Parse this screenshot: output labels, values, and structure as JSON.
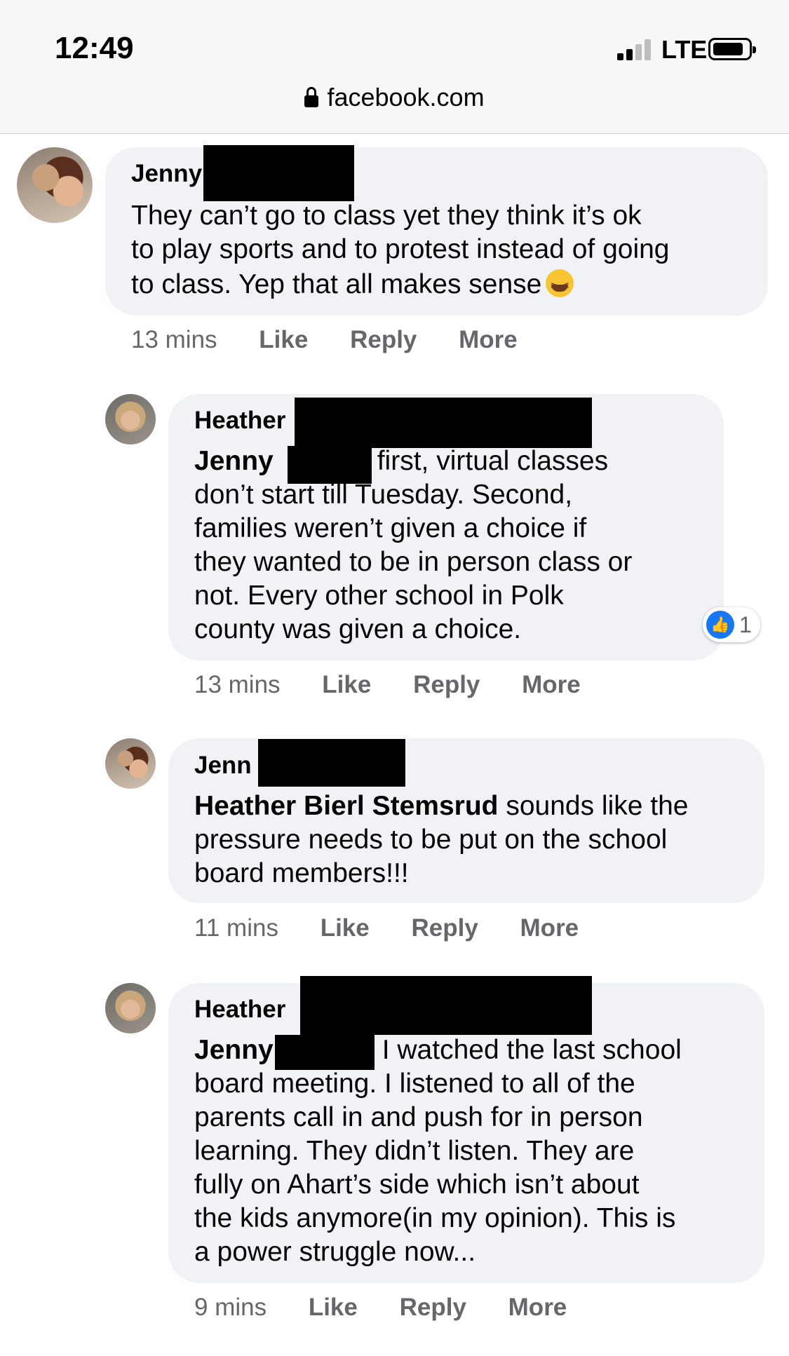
{
  "status_bar": {
    "time": "12:49",
    "network": "LTE"
  },
  "url_bar": {
    "domain": "facebook.com"
  },
  "comments": [
    {
      "author": "Jenny",
      "lines": [
        "They can’t go to class yet they think it’s ok",
        "to play sports and to protest instead of going",
        "to class. Yep that all makes sense"
      ],
      "emoji": "grinning-squinting-face",
      "time": "13 mins",
      "like": "Like",
      "reply": "Reply",
      "more": "More"
    },
    {
      "author": "Heather",
      "mention": "Jenny",
      "lines": [
        "first, virtual classes",
        "don’t start till Tuesday. Second,",
        "families weren’t given a choice if",
        "they wanted to be in person class or",
        "not. Every other school in Polk",
        "county was given a choice."
      ],
      "reaction_count": "1",
      "time": "13 mins",
      "like": "Like",
      "reply": "Reply",
      "more": "More"
    },
    {
      "author": "Jenn",
      "mention": "Heather Bierl Stemsrud",
      "lines": [
        " sounds like the",
        "pressure needs to be put on the school",
        "board members!!!"
      ],
      "time": "11 mins",
      "like": "Like",
      "reply": "Reply",
      "more": "More"
    },
    {
      "author": "Heather",
      "mention": "Jenny",
      "lines": [
        "I watched the last school",
        "board meeting. I listened to all of the",
        "parents call in and push for in person",
        "learning. They didn’t listen. They are",
        "fully on Ahart’s side which isn’t about",
        "the kids anymore(in my opinion). This is",
        "a power struggle now..."
      ],
      "time": "9 mins",
      "like": "Like",
      "reply": "Reply",
      "more": "More"
    }
  ],
  "colors": {
    "bubble": "#f0f2f5",
    "secondary_text": "#65676b",
    "like_blue": "#1877f2"
  },
  "icons": {
    "lock": "lock-icon",
    "reaction": "thumbs-up-icon"
  }
}
